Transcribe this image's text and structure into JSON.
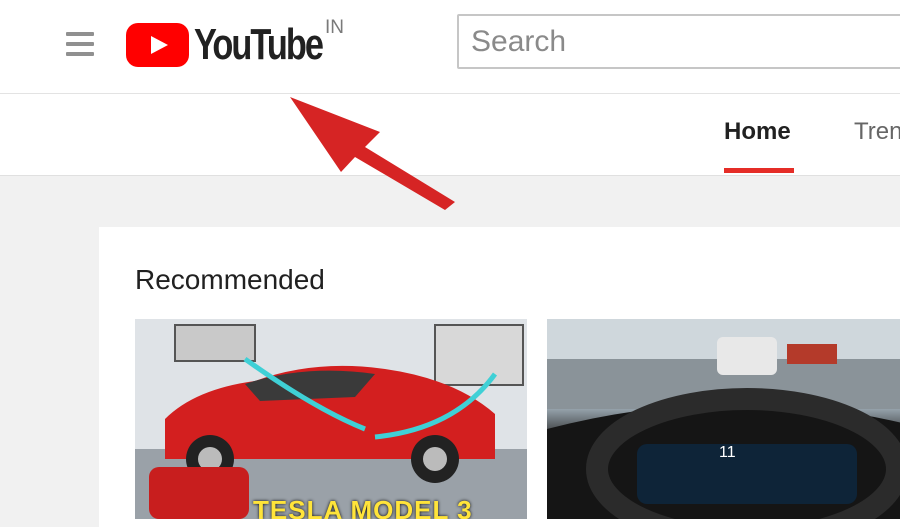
{
  "masthead": {
    "logo_text": "YouTube",
    "region": "IN",
    "search_placeholder": "Search"
  },
  "tabs": [
    {
      "label": "Home",
      "active": true
    },
    {
      "label": "Tren",
      "active": false
    }
  ],
  "main": {
    "section_title": "Recommended"
  },
  "videos": [
    {
      "thumbnail_text": "TESLA MODEL 3"
    },
    {
      "dashboard_speed": "11"
    }
  ],
  "colors": {
    "brand_red": "#ff0000",
    "tab_underline": "#e52d27",
    "annotation_arrow": "#d62424"
  },
  "icons": [
    "hamburger-menu-icon",
    "youtube-play-icon",
    "annotation-arrow"
  ]
}
